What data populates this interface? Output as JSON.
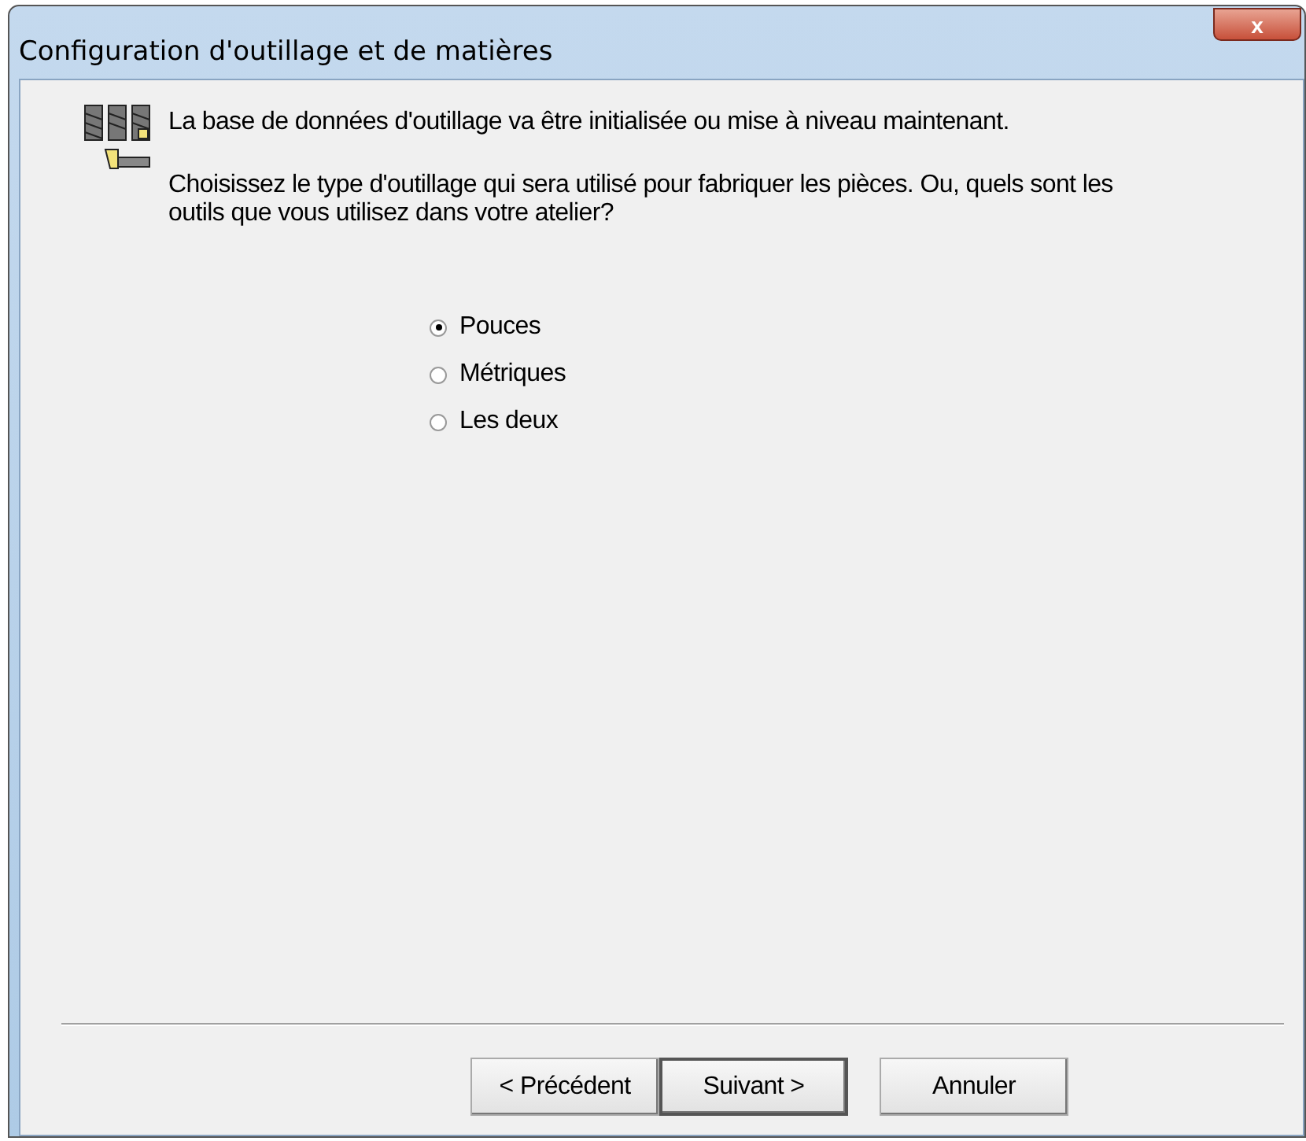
{
  "window": {
    "title": "Configuration d'outillage et de matières",
    "close": "x"
  },
  "intro": "La base de données d'outillage va être initialisée ou mise à niveau maintenant.",
  "question": "Choisissez le type d'outillage qui sera utilisé pour fabriquer les pièces.  Ou, quels sont les outils que vous utilisez dans votre atelier?",
  "options": [
    {
      "label": "Pouces",
      "selected": true
    },
    {
      "label": "Métriques",
      "selected": false
    },
    {
      "label": "Les deux",
      "selected": false
    }
  ],
  "buttons": [
    {
      "label": "< Précédent",
      "default": false
    },
    {
      "label": "Suivant >",
      "default": true
    },
    {
      "label": "Annuler",
      "default": false
    }
  ]
}
